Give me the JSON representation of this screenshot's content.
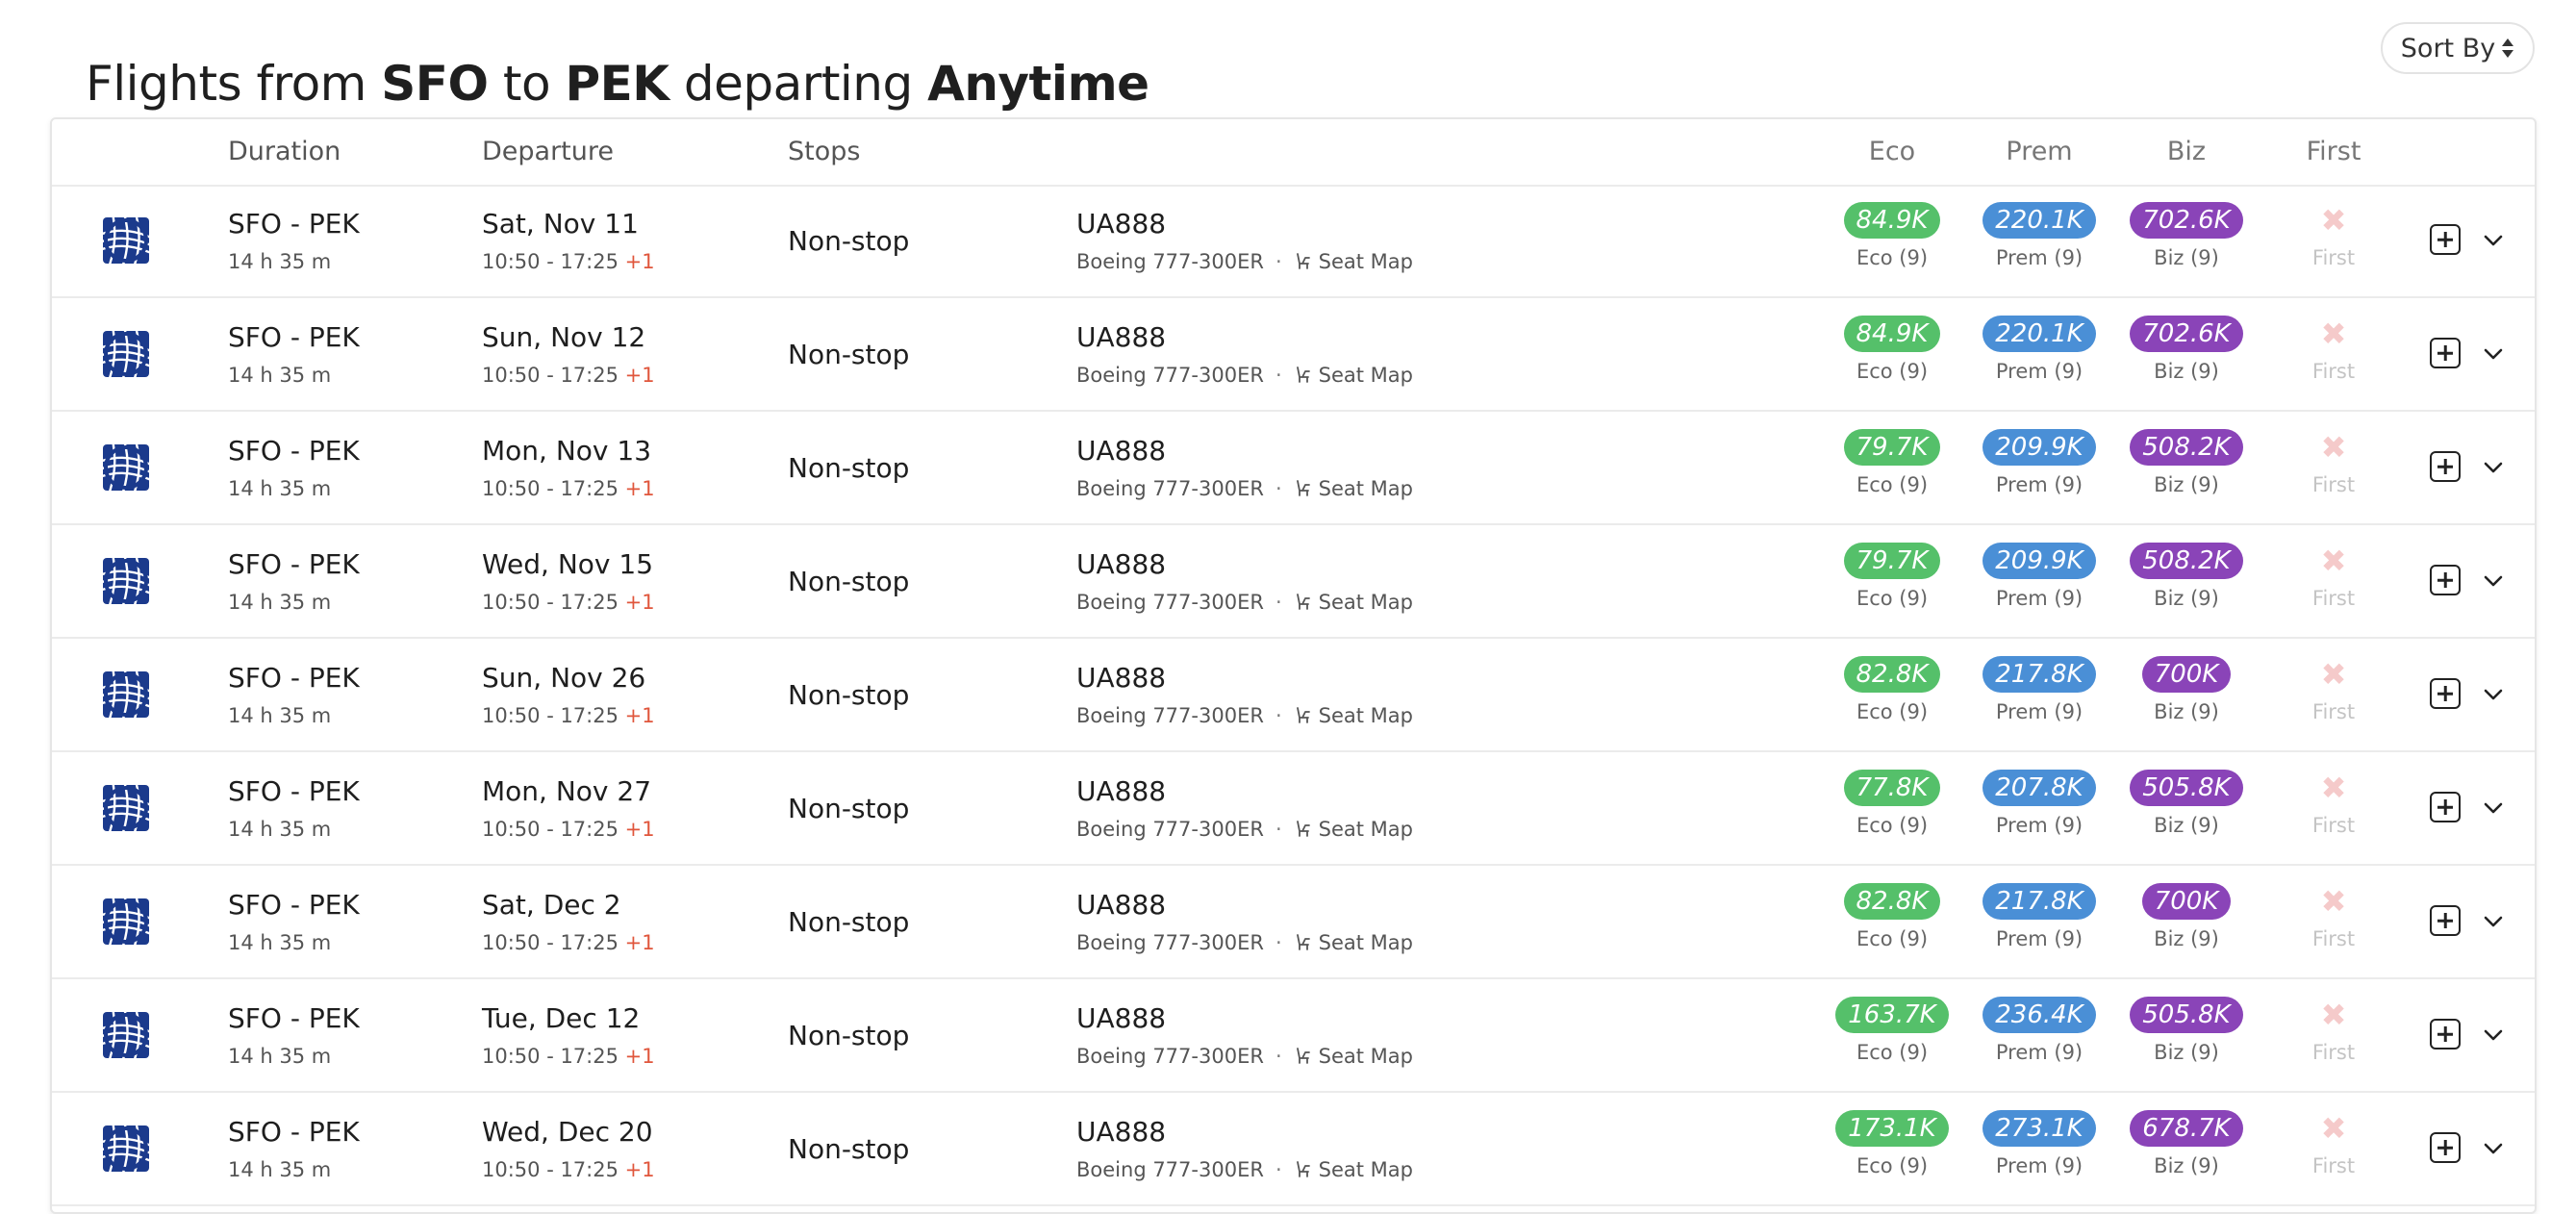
{
  "header": {
    "title_parts": [
      "Flights from ",
      "SFO",
      " to ",
      "PEK",
      " departing ",
      "Anytime"
    ],
    "sort_label": "Sort By"
  },
  "columns": {
    "duration": "Duration",
    "departure": "Departure",
    "stops": "Stops",
    "eco": "Eco",
    "prem": "Prem",
    "biz": "Biz",
    "first": "First"
  },
  "colors": {
    "eco": "#55c06a",
    "prem": "#4a8fd6",
    "biz": "#8a44b8",
    "first_unavailable": "#f5caca",
    "next_day": "#e0563c",
    "airline_logo": "#1b3a8c"
  },
  "icons": {
    "logo": "united-airlines-globe-icon",
    "seat": "seat-icon",
    "sort": "sort-updown-icon",
    "add": "plus-square-icon",
    "expand": "chevron-down-icon",
    "unavailable": "x-mark-icon"
  },
  "flights": [
    {
      "route": "SFO - PEK",
      "duration": "14 h 35 m",
      "date": "Sat, Nov 11",
      "times": "10:50 - 17:25 ",
      "next_day": "+1",
      "stops": "Non-stop",
      "flight": "UA888",
      "aircraft": "Boeing 777-300ER",
      "seat_map": "Seat Map",
      "eco": "84.9K",
      "eco_label": "Eco (9)",
      "prem": "220.1K",
      "prem_label": "Prem (9)",
      "biz": "702.6K",
      "biz_label": "Biz (9)",
      "first": "✖",
      "first_label": "First"
    },
    {
      "route": "SFO - PEK",
      "duration": "14 h 35 m",
      "date": "Sun, Nov 12",
      "times": "10:50 - 17:25 ",
      "next_day": "+1",
      "stops": "Non-stop",
      "flight": "UA888",
      "aircraft": "Boeing 777-300ER",
      "seat_map": "Seat Map",
      "eco": "84.9K",
      "eco_label": "Eco (9)",
      "prem": "220.1K",
      "prem_label": "Prem (9)",
      "biz": "702.6K",
      "biz_label": "Biz (9)",
      "first": "✖",
      "first_label": "First"
    },
    {
      "route": "SFO - PEK",
      "duration": "14 h 35 m",
      "date": "Mon, Nov 13",
      "times": "10:50 - 17:25 ",
      "next_day": "+1",
      "stops": "Non-stop",
      "flight": "UA888",
      "aircraft": "Boeing 777-300ER",
      "seat_map": "Seat Map",
      "eco": "79.7K",
      "eco_label": "Eco (9)",
      "prem": "209.9K",
      "prem_label": "Prem (9)",
      "biz": "508.2K",
      "biz_label": "Biz (9)",
      "first": "✖",
      "first_label": "First"
    },
    {
      "route": "SFO - PEK",
      "duration": "14 h 35 m",
      "date": "Wed, Nov 15",
      "times": "10:50 - 17:25 ",
      "next_day": "+1",
      "stops": "Non-stop",
      "flight": "UA888",
      "aircraft": "Boeing 777-300ER",
      "seat_map": "Seat Map",
      "eco": "79.7K",
      "eco_label": "Eco (9)",
      "prem": "209.9K",
      "prem_label": "Prem (9)",
      "biz": "508.2K",
      "biz_label": "Biz (9)",
      "first": "✖",
      "first_label": "First"
    },
    {
      "route": "SFO - PEK",
      "duration": "14 h 35 m",
      "date": "Sun, Nov 26",
      "times": "10:50 - 17:25 ",
      "next_day": "+1",
      "stops": "Non-stop",
      "flight": "UA888",
      "aircraft": "Boeing 777-300ER",
      "seat_map": "Seat Map",
      "eco": "82.8K",
      "eco_label": "Eco (9)",
      "prem": "217.8K",
      "prem_label": "Prem (9)",
      "biz": "700K",
      "biz_label": "Biz (9)",
      "first": "✖",
      "first_label": "First"
    },
    {
      "route": "SFO - PEK",
      "duration": "14 h 35 m",
      "date": "Mon, Nov 27",
      "times": "10:50 - 17:25 ",
      "next_day": "+1",
      "stops": "Non-stop",
      "flight": "UA888",
      "aircraft": "Boeing 777-300ER",
      "seat_map": "Seat Map",
      "eco": "77.8K",
      "eco_label": "Eco (9)",
      "prem": "207.8K",
      "prem_label": "Prem (9)",
      "biz": "505.8K",
      "biz_label": "Biz (9)",
      "first": "✖",
      "first_label": "First"
    },
    {
      "route": "SFO - PEK",
      "duration": "14 h 35 m",
      "date": "Sat, Dec 2",
      "times": "10:50 - 17:25 ",
      "next_day": "+1",
      "stops": "Non-stop",
      "flight": "UA888",
      "aircraft": "Boeing 777-300ER",
      "seat_map": "Seat Map",
      "eco": "82.8K",
      "eco_label": "Eco (9)",
      "prem": "217.8K",
      "prem_label": "Prem (9)",
      "biz": "700K",
      "biz_label": "Biz (9)",
      "first": "✖",
      "first_label": "First"
    },
    {
      "route": "SFO - PEK",
      "duration": "14 h 35 m",
      "date": "Tue, Dec 12",
      "times": "10:50 - 17:25 ",
      "next_day": "+1",
      "stops": "Non-stop",
      "flight": "UA888",
      "aircraft": "Boeing 777-300ER",
      "seat_map": "Seat Map",
      "eco": "163.7K",
      "eco_label": "Eco (9)",
      "prem": "236.4K",
      "prem_label": "Prem (9)",
      "biz": "505.8K",
      "biz_label": "Biz (9)",
      "first": "✖",
      "first_label": "First"
    },
    {
      "route": "SFO - PEK",
      "duration": "14 h 35 m",
      "date": "Wed, Dec 20",
      "times": "10:50 - 17:25 ",
      "next_day": "+1",
      "stops": "Non-stop",
      "flight": "UA888",
      "aircraft": "Boeing 777-300ER",
      "seat_map": "Seat Map",
      "eco": "173.1K",
      "eco_label": "Eco (9)",
      "prem": "273.1K",
      "prem_label": "Prem (9)",
      "biz": "678.7K",
      "biz_label": "Biz (9)",
      "first": "✖",
      "first_label": "First"
    }
  ]
}
